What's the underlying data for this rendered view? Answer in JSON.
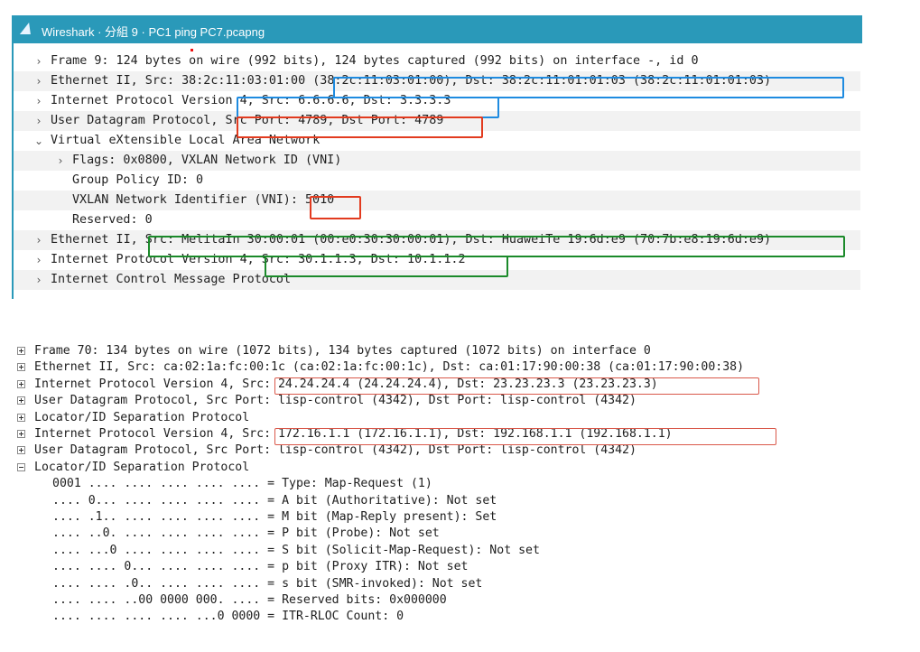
{
  "window": {
    "title": "Wireshark · 分組 9 · PC1 ping PC7.pcapng",
    "logo_icon": "wireshark-fin-icon",
    "titlebar_color": "#2a99b9"
  },
  "packet_tree": [
    {
      "text": "Frame 9: 124 bytes on wire (992 bits), 124 bytes captured (992 bits) on interface -, id 0",
      "expander": "collapsed"
    },
    {
      "text": "Ethernet II, Src: 38:2c:11:03:01:00 (38:2c:11:03:01:00), Dst: 38:2c:11:01:01:03 (38:2c:11:01:01:03)",
      "expander": "collapsed"
    },
    {
      "text": "Internet Protocol Version 4, Src: 6.6.6.6, Dst: 3.3.3.3",
      "expander": "collapsed"
    },
    {
      "text": "User Datagram Protocol, Src Port: 4789, Dst Port: 4789",
      "expander": "collapsed"
    },
    {
      "text": "Virtual eXtensible Local Area Network",
      "expander": "expanded"
    },
    {
      "text": "Flags: 0x0800, VXLAN Network ID (VNI)",
      "expander": "collapsed"
    },
    {
      "text": "Group Policy ID: 0",
      "expander": "none"
    },
    {
      "text": "VXLAN Network Identifier (VNI): 5010",
      "expander": "none"
    },
    {
      "text": "Reserved: 0",
      "expander": "none"
    },
    {
      "text": "Ethernet II, Src: MelitaIn 30:00:01 (00:e0:30:30:00:01), Dst: HuaweiTe 19:6d:e9 (70:7b:e8:19:6d:e9)",
      "expander": "collapsed"
    },
    {
      "text": "Internet Protocol Version 4, Src: 30.1.1.3, Dst: 10.1.1.2",
      "expander": "collapsed"
    },
    {
      "text": "Internet Control Message Protocol",
      "expander": "collapsed"
    }
  ],
  "highlight_colors": {
    "blue": "#1e8be0",
    "red": "#e23b1f",
    "green": "#1b8a2a"
  },
  "lisp_tree": [
    {
      "text": "Frame 70: 134 bytes on wire (1072 bits), 134 bytes captured (1072 bits) on interface 0",
      "expander": "plus"
    },
    {
      "text": "Ethernet II, Src: ca:02:1a:fc:00:1c (ca:02:1a:fc:00:1c), Dst: ca:01:17:90:00:38 (ca:01:17:90:00:38)",
      "expander": "plus"
    },
    {
      "text": "Internet Protocol Version 4, Src: 24.24.24.4 (24.24.24.4), Dst: 23.23.23.3 (23.23.23.3)",
      "expander": "plus"
    },
    {
      "text": "User Datagram Protocol, Src Port: lisp-control (4342), Dst Port: lisp-control (4342)",
      "expander": "plus"
    },
    {
      "text": "Locator/ID Separation Protocol",
      "expander": "plus"
    },
    {
      "text": "Internet Protocol Version 4, Src: 172.16.1.1 (172.16.1.1), Dst: 192.168.1.1 (192.168.1.1)",
      "expander": "plus"
    },
    {
      "text": "User Datagram Protocol, Src Port: lisp-control (4342), Dst Port: lisp-control (4342)",
      "expander": "plus"
    },
    {
      "text": "Locator/ID Separation Protocol",
      "expander": "minus"
    },
    {
      "text": "0001 .... .... .... .... .... = Type: Map-Request (1)",
      "expander": "none"
    },
    {
      "text": ".... 0... .... .... .... .... = A bit (Authoritative): Not set",
      "expander": "none"
    },
    {
      "text": ".... .1.. .... .... .... .... = M bit (Map-Reply present): Set",
      "expander": "none"
    },
    {
      "text": ".... ..0. .... .... .... .... = P bit (Probe): Not set",
      "expander": "none"
    },
    {
      "text": ".... ...0 .... .... .... .... = S bit (Solicit-Map-Request): Not set",
      "expander": "none"
    },
    {
      "text": ".... .... 0... .... .... .... = p bit (Proxy ITR): Not set",
      "expander": "none"
    },
    {
      "text": ".... .... .0.. .... .... .... = s bit (SMR-invoked): Not set",
      "expander": "none"
    },
    {
      "text": ".... .... ..00 0000 000. .... = Reserved bits: 0x000000",
      "expander": "none"
    },
    {
      "text": ".... .... .... .... ...0 0000 = ITR-RLOC Count: 0",
      "expander": "none"
    }
  ]
}
